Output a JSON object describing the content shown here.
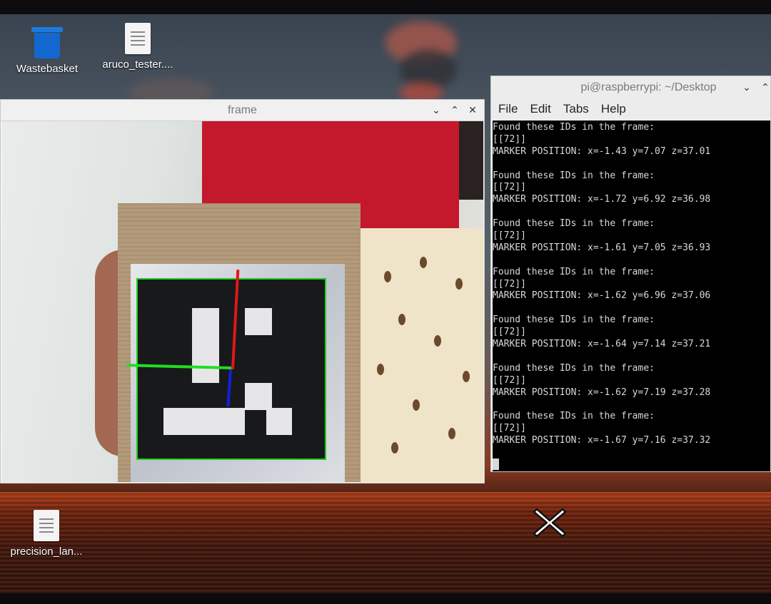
{
  "desktop": {
    "icons": [
      {
        "label": "Wastebasket",
        "icon": "trash-icon"
      },
      {
        "label": "aruco_tester....",
        "icon": "text-file-icon"
      },
      {
        "label": "precision_lan...",
        "icon": "text-file-icon"
      }
    ]
  },
  "frame_window": {
    "title": "frame",
    "controls": [
      "⌄",
      "⌃",
      "✕"
    ]
  },
  "terminal_window": {
    "title": "pi@raspberrypi: ~/Desktop",
    "menu": [
      "File",
      "Edit",
      "Tabs",
      "Help"
    ],
    "lines": [
      "Found these IDs in the frame:",
      "[[72]]",
      "MARKER POSITION: x=-1.43 y=7.07 z=37.01",
      "",
      "Found these IDs in the frame:",
      "[[72]]",
      "MARKER POSITION: x=-1.72 y=6.92 z=36.98",
      "",
      "Found these IDs in the frame:",
      "[[72]]",
      "MARKER POSITION: x=-1.61 y=7.05 z=36.93",
      "",
      "Found these IDs in the frame:",
      "[[72]]",
      "MARKER POSITION: x=-1.62 y=6.96 z=37.06",
      "",
      "Found these IDs in the frame:",
      "[[72]]",
      "MARKER POSITION: x=-1.64 y=7.14 z=37.21",
      "",
      "Found these IDs in the frame:",
      "[[72]]",
      "MARKER POSITION: x=-1.62 y=7.19 z=37.28",
      "",
      "Found these IDs in the frame:",
      "[[72]]",
      "MARKER POSITION: x=-1.67 y=7.16 z=37.32"
    ]
  },
  "colors": {
    "accent_blue": "#1368cf",
    "marker_outline": "#1fd01f",
    "axis_x": "#22dd22",
    "axis_y": "#e01818",
    "axis_z": "#1020e0"
  }
}
